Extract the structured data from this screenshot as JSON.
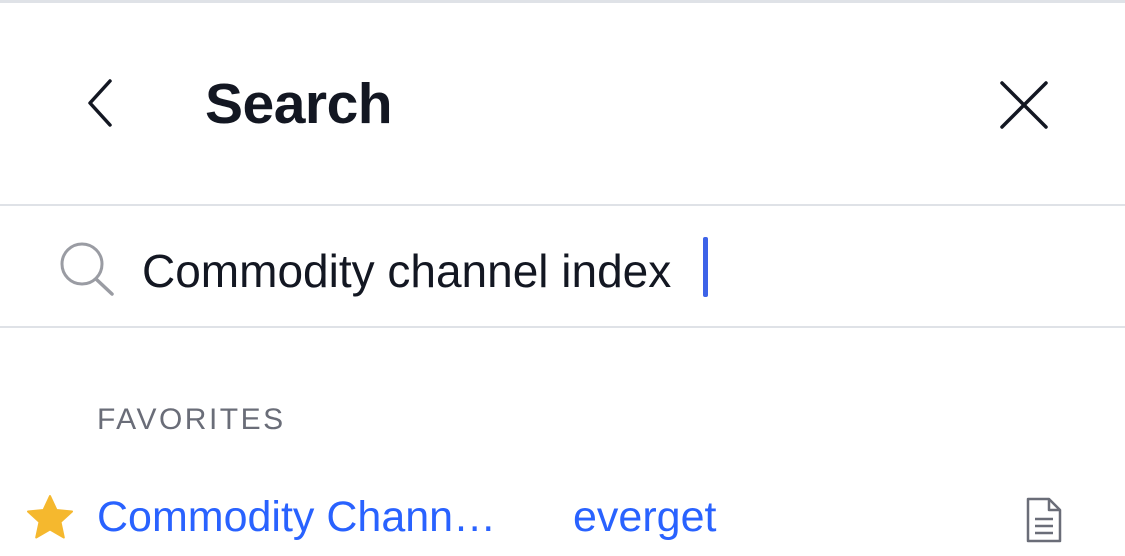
{
  "header": {
    "title": "Search",
    "back_icon": "chevron-left-icon",
    "close_icon": "close-icon"
  },
  "search": {
    "icon": "search-icon",
    "value": "Commodity channel index",
    "placeholder": ""
  },
  "favorites": {
    "label": "FAVORITES",
    "items": [
      {
        "icon": "star-icon",
        "name": "Commodity Chann…",
        "author": "everget",
        "trailing_icon": "document-icon"
      }
    ]
  },
  "colors": {
    "accent": "#2962ff",
    "star": "#f5b82e",
    "text": "#131722",
    "muted": "#6a6d78",
    "divider": "#dfe2e7",
    "caret": "#3d63e8"
  }
}
